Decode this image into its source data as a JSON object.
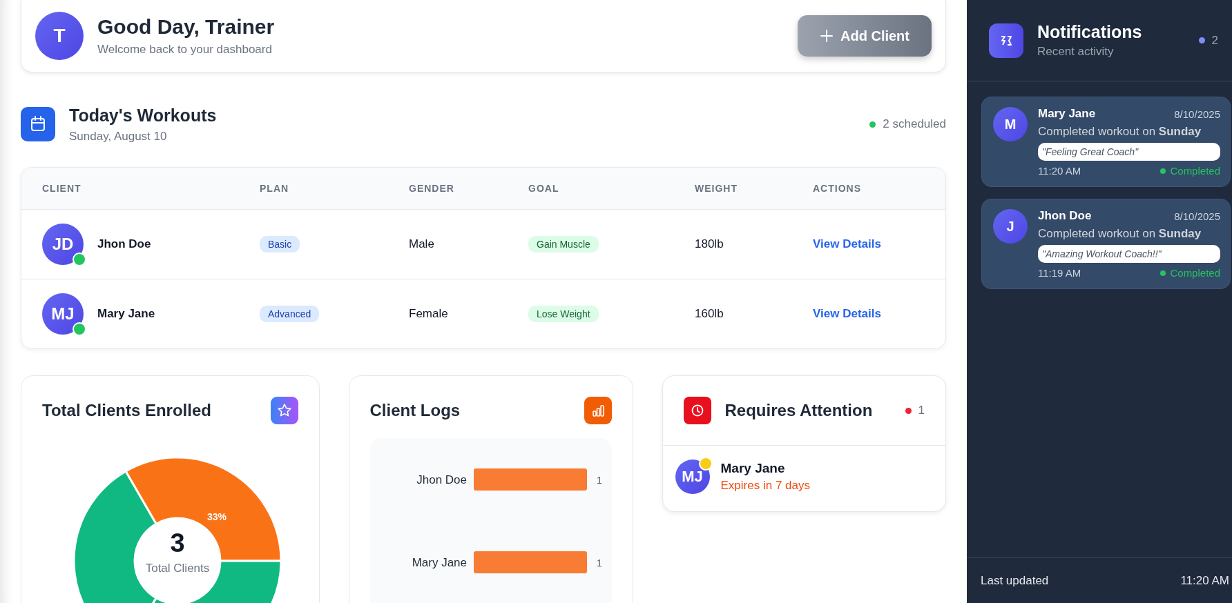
{
  "header": {
    "avatar_initial": "T",
    "greeting": "Good Day, Trainer",
    "subtitle": "Welcome back to your dashboard",
    "add_button": "Add Client"
  },
  "workouts": {
    "title": "Today's Workouts",
    "date": "Sunday, August 10",
    "scheduled": "2 scheduled",
    "table": {
      "columns": [
        "CLIENT",
        "PLAN",
        "GENDER",
        "GOAL",
        "WEIGHT",
        "ACTIONS"
      ],
      "rows": [
        {
          "initials": "JD",
          "name": "Jhon Doe",
          "online": true,
          "plan": "Basic",
          "gender": "Male",
          "goal": "Gain Muscle",
          "weight": "180lb",
          "action": "View Details"
        },
        {
          "initials": "MJ",
          "name": "Mary Jane",
          "online": true,
          "plan": "Advanced",
          "gender": "Female",
          "goal": "Lose Weight",
          "weight": "160lb",
          "action": "View Details"
        }
      ]
    }
  },
  "total_clients": {
    "title": "Total Clients Enrolled",
    "slice_label": "33%",
    "total": "3",
    "total_label": "Total Clients"
  },
  "client_logs": {
    "title": "Client Logs",
    "chart_data": {
      "type": "bar",
      "orientation": "horizontal",
      "categories": [
        "Jhon Doe",
        "Mary Jane"
      ],
      "values": [
        1,
        1
      ],
      "data_labels": true
    }
  },
  "requires_attention": {
    "title": "Requires Attention",
    "count": "1",
    "items": [
      {
        "initials": "MJ",
        "name": "Mary Jane",
        "note": "Expires in 7 days"
      }
    ]
  },
  "notifications": {
    "title": "Notifications",
    "subtitle": "Recent activity",
    "count": "2",
    "items": [
      {
        "initial": "M",
        "name": "Mary Jane",
        "date": "8/10/2025",
        "message": "Completed workout on **Sunday**",
        "quote": "\"Feeling Great Coach\"",
        "time": "11:20 AM",
        "status": "Completed"
      },
      {
        "initial": "J",
        "name": "Jhon Doe",
        "date": "8/10/2025",
        "message": "Completed workout on **Sunday**",
        "quote": "\"Amazing Workout Coach!!\"",
        "time": "11:19 AM",
        "status": "Completed"
      }
    ],
    "footer": {
      "label": "Last updated",
      "time": "11:20 AM"
    }
  }
}
